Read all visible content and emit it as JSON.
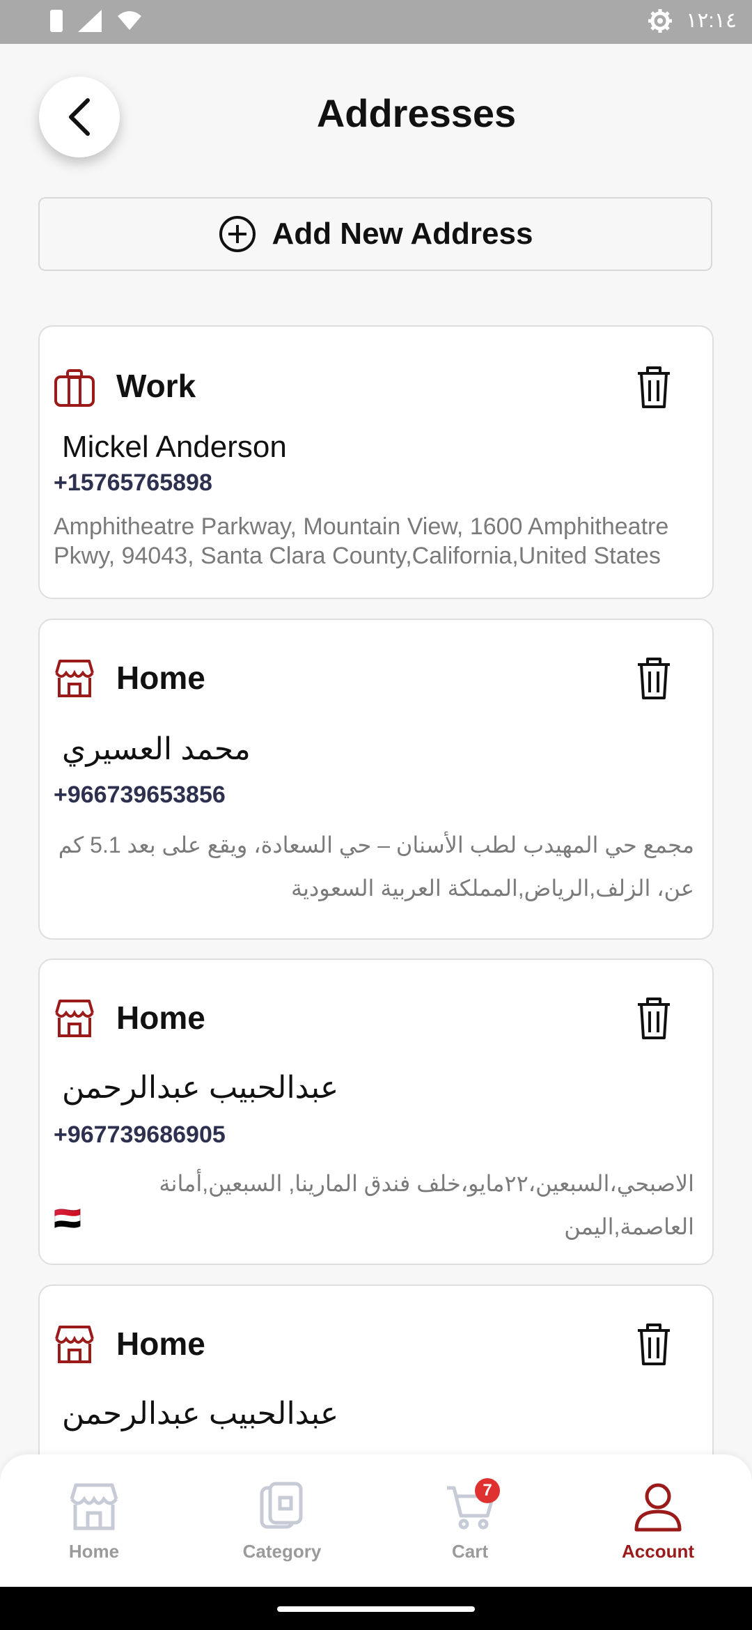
{
  "status_bar": {
    "time": "١٢:١٤"
  },
  "header": {
    "title": "Addresses"
  },
  "add_button": {
    "label": "Add New Address"
  },
  "addresses": [
    {
      "type": "Work",
      "name": "Mickel Anderson",
      "phone": "+15765765898",
      "address": "Amphitheatre Parkway, Mountain View, 1600 Amphitheatre Pkwy, 94043, Santa Clara County,California,United States"
    },
    {
      "type": "Home",
      "name": "محمد العسيري",
      "phone": "+966739653856",
      "address": "مجمع حي المهيدب لطب الأسنان – حي السعادة، ويقع على بعد 5.1 كم عن، الزلف,الرياض,المملكة العربية السعودية"
    },
    {
      "type": "Home",
      "name": "عبدالحبيب عبدالرحمن",
      "phone": "+967739686905",
      "address": "الاصبحي،السبعين،٢٢مايو،خلف فندق المارينا, السبعين,أمانة العاصمة,اليمن",
      "flag": "🇾🇪"
    },
    {
      "type": "Home",
      "name": "عبدالحبيب عبدالرحمن"
    }
  ],
  "bottom_nav": {
    "items": [
      {
        "label": "Home",
        "icon": "store-icon"
      },
      {
        "label": "Category",
        "icon": "category-icon"
      },
      {
        "label": "Cart",
        "icon": "cart-icon",
        "badge": "7"
      },
      {
        "label": "Account",
        "icon": "user-icon",
        "active": true
      }
    ]
  },
  "colors": {
    "accent": "#9b1b1b",
    "badge": "#e03131",
    "phone_text": "#2e3050",
    "address_text": "#7a7a7a",
    "inactive_nav": "#9a9a9a"
  }
}
